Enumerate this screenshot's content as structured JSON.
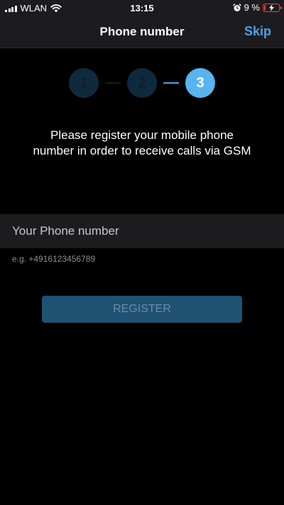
{
  "status_bar": {
    "carrier": "WLAN",
    "time": "13:15",
    "battery_percent": "9 %",
    "battery_level": 0.09,
    "icons": [
      "cellular-signal-icon",
      "wifi-icon",
      "alarm-icon",
      "battery-charging-icon"
    ],
    "battery_color": "#ff3b30"
  },
  "nav": {
    "title": "Phone number",
    "skip_label": "Skip",
    "accent_color": "#4aa3e8"
  },
  "steps": {
    "items": [
      {
        "label": "1",
        "state": "inactive"
      },
      {
        "label": "2",
        "state": "inactive"
      },
      {
        "label": "3",
        "state": "active"
      }
    ],
    "active_color": "#58b4f0",
    "inactive_color": "#0f2a3d"
  },
  "message": "Please register your mobile phone number in order to receive calls via GSM",
  "phone_field": {
    "placeholder": "Your Phone number",
    "value": ""
  },
  "hint": "e.g. +4916123456789",
  "register_button": {
    "label": "REGISTER",
    "background": "#1f5273"
  }
}
